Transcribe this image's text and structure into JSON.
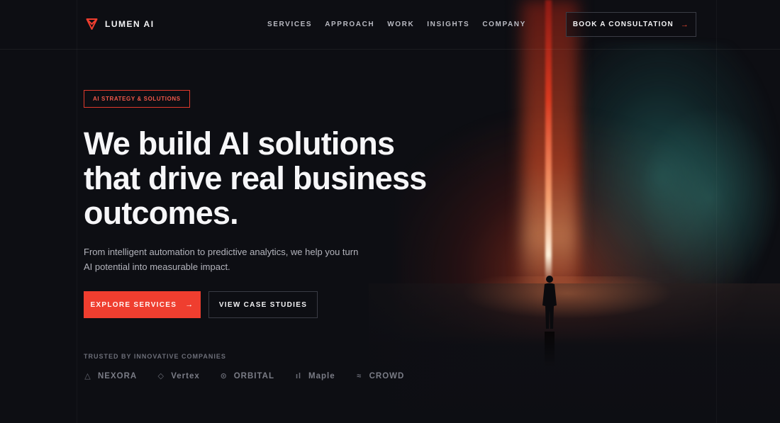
{
  "brand": {
    "name": "LUMEN AI",
    "accent": "#ef3e2f"
  },
  "nav": {
    "items": [
      {
        "label": "SERVICES"
      },
      {
        "label": "APPROACH"
      },
      {
        "label": "WORK"
      },
      {
        "label": "INSIGHTS"
      },
      {
        "label": "COMPANY"
      }
    ],
    "cta_label": "BOOK A CONSULTATION",
    "cta_icon": "arrow-right-icon"
  },
  "hero": {
    "badge": "AI STRATEGY & SOLUTIONS",
    "headline_lines": [
      "We build AI solutions",
      "that drive real business",
      "outcomes."
    ],
    "subtitle_lines": [
      "From intelligent automation to predictive analytics, we help you turn",
      "AI potential into measurable impact."
    ],
    "primary_button": "EXPLORE SERVICES",
    "secondary_button": "VIEW CASE STUDIES"
  },
  "trusted": {
    "label": "TRUSTED BY INNOVATIVE COMPANIES",
    "companies": [
      {
        "name": "NEXORA",
        "icon": "triangle-outline-icon",
        "glyph": "△"
      },
      {
        "name": "Vertex",
        "icon": "diamond-outline-icon",
        "glyph": "◇"
      },
      {
        "name": "ORBITAL",
        "icon": "circle-dot-icon",
        "glyph": "⊙"
      },
      {
        "name": "Maple",
        "icon": "bars-icon",
        "glyph": "ıl"
      },
      {
        "name": "CROWD",
        "icon": "waves-icon",
        "glyph": "≈"
      }
    ]
  }
}
